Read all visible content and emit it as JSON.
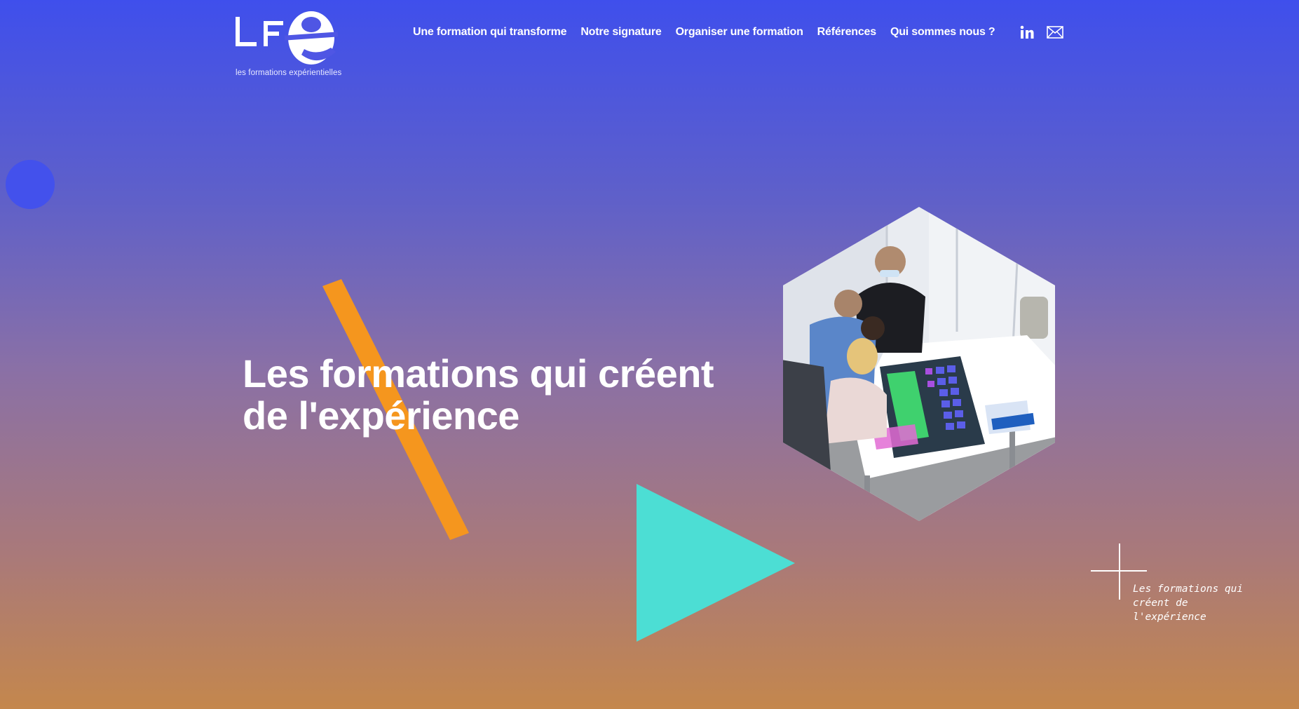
{
  "brand": {
    "logo_letters": "LFe",
    "tagline": "les formations expérientielles"
  },
  "nav": {
    "items": [
      {
        "label": "Une formation qui transforme"
      },
      {
        "label": "Notre signature"
      },
      {
        "label": "Organiser une formation"
      },
      {
        "label": "Références"
      },
      {
        "label": "Qui sommes nous ?"
      }
    ]
  },
  "social": {
    "icons": [
      "linkedin-icon",
      "mail-icon"
    ]
  },
  "hero": {
    "title_line1": "Les formations qui créent",
    "title_line2": "de l'expérience"
  },
  "side_caption": "Les formations qui créent de l'expérience",
  "colors": {
    "gradient_top": "#3f4fec",
    "gradient_bottom": "#c4874d",
    "accent_orange": "#f5961e",
    "accent_turquoise": "#4cded4",
    "accent_blue_circle": "#4351ec"
  }
}
